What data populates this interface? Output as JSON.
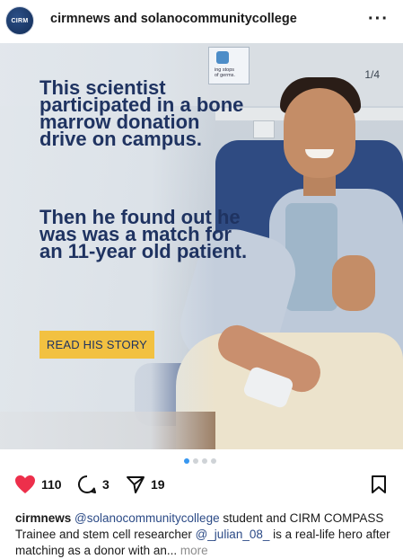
{
  "header": {
    "account_title": "cirmnews and solanocommunitycollege",
    "avatar_text": "CIRM",
    "more_icon": "more-dots-icon"
  },
  "post": {
    "page_indicator": "1/4",
    "wall_sign_text": "ing stops\nof germs.",
    "headline_1": "This scientist participated in a bone marrow donation drive on campus.",
    "headline_2": "Then he found out he was was a match for an 11-year old patient.",
    "cta_label": "READ HIS STORY",
    "colors": {
      "headline": "#1f3361",
      "cta_bg": "#f2c141"
    }
  },
  "carousel": {
    "count": 4,
    "active_index": 0
  },
  "actions": {
    "likes": "110",
    "comments": "3",
    "shares": "19",
    "icons": [
      "heart-icon",
      "comment-icon",
      "share-icon",
      "bookmark-icon"
    ],
    "like_color": "#ed2f4b"
  },
  "caption": {
    "user": "cirmnews",
    "mention_1": "@solanocommunitycollege",
    "text_1": " student and CIRM COMPASS Trainee and stem cell researcher ",
    "mention_2": "@_julian_08_",
    "text_2": " is a real-life hero after matching as a donor with an...",
    "more_label": "more"
  }
}
